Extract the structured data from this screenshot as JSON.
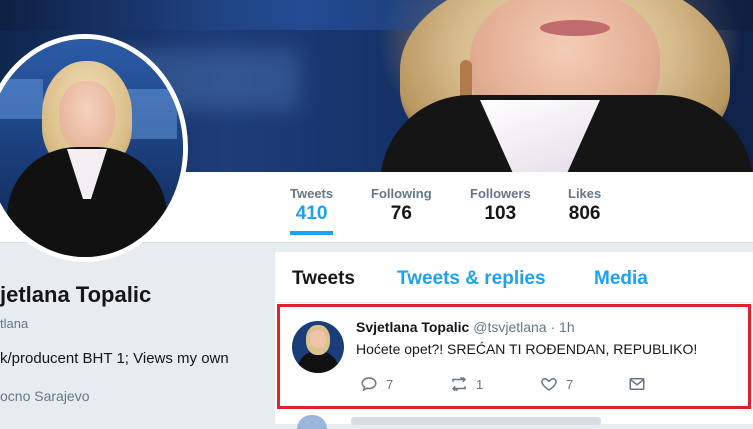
{
  "profile": {
    "name": "jetlana Topalic",
    "handle": "tlana",
    "bio": "k/producent BHT 1; Views my own",
    "location": "ocno Sarajevo"
  },
  "stats": [
    {
      "label": "Tweets",
      "value": "410"
    },
    {
      "label": "Following",
      "value": "76"
    },
    {
      "label": "Followers",
      "value": "103"
    },
    {
      "label": "Likes",
      "value": "806"
    }
  ],
  "timeline": {
    "tabs": [
      "Tweets",
      "Tweets & replies",
      "Media"
    ],
    "tweet": {
      "name": "Svjetlana Topalic",
      "meta": "@tsvjetlana · 1h",
      "text": "Hoćete opet?! SREĆAN TI ROĐENDAN, REPUBLIKO!",
      "reply_count": "7",
      "retweet_count": "1",
      "like_count": "7"
    }
  },
  "icons": {
    "reply": "reply-icon",
    "retweet": "retweet-icon",
    "like": "heart-icon",
    "dm": "envelope-icon"
  },
  "colors": {
    "accent": "#1da1f2",
    "highlight_border": "#e0202a"
  }
}
